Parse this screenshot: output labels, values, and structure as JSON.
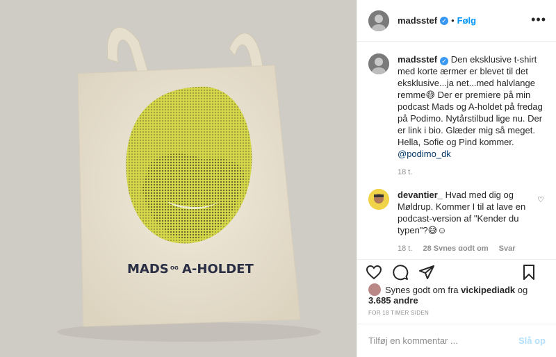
{
  "header": {
    "username": "madsstef",
    "separator": "•",
    "follow_label": "Følg",
    "more_icon": "more-horizontal-icon"
  },
  "photo": {
    "bag_text_left": "MADS",
    "bag_text_mid": "OG",
    "bag_text_right": "A-HOLDET",
    "colors": {
      "background": "#cfccc6",
      "bag": "#ece5d4",
      "face": "#d6d84a"
    }
  },
  "caption": {
    "username": "madsstef",
    "text": "Den eksklusive t-shirt med korte ærmer er blevet til det eksklusive...ja net...med halvlange remme😅 Der er premiere på min podcast Mads og A-holdet på fredag på Podimo. Nytårstilbud lige nu. Der er link i bio. Glæder mig så meget. Hella, Sofie og Pind kommer.",
    "mention": "@podimo_dk",
    "time": "18 t."
  },
  "comment": {
    "username": "devantier_",
    "text": "Hvad med dig og Møldrup. Kommer I til at lave en podcast-version af \"Kender du typen\"?😅☺",
    "time": "18 t.",
    "likes": "28 Synes godt om",
    "reply": "Svar"
  },
  "likes": {
    "prefix": "Synes godt om fra",
    "user": "vickipediadk",
    "joiner": "og",
    "others": "3.685 andre"
  },
  "timestamp": "FOR 18 TIMER SIDEN",
  "add_comment": {
    "placeholder": "Tilføj en kommentar ...",
    "post_label": "Slå op"
  },
  "colors": {
    "accent": "#0095f6",
    "link": "#00376b",
    "muted": "#8e8e8e"
  }
}
